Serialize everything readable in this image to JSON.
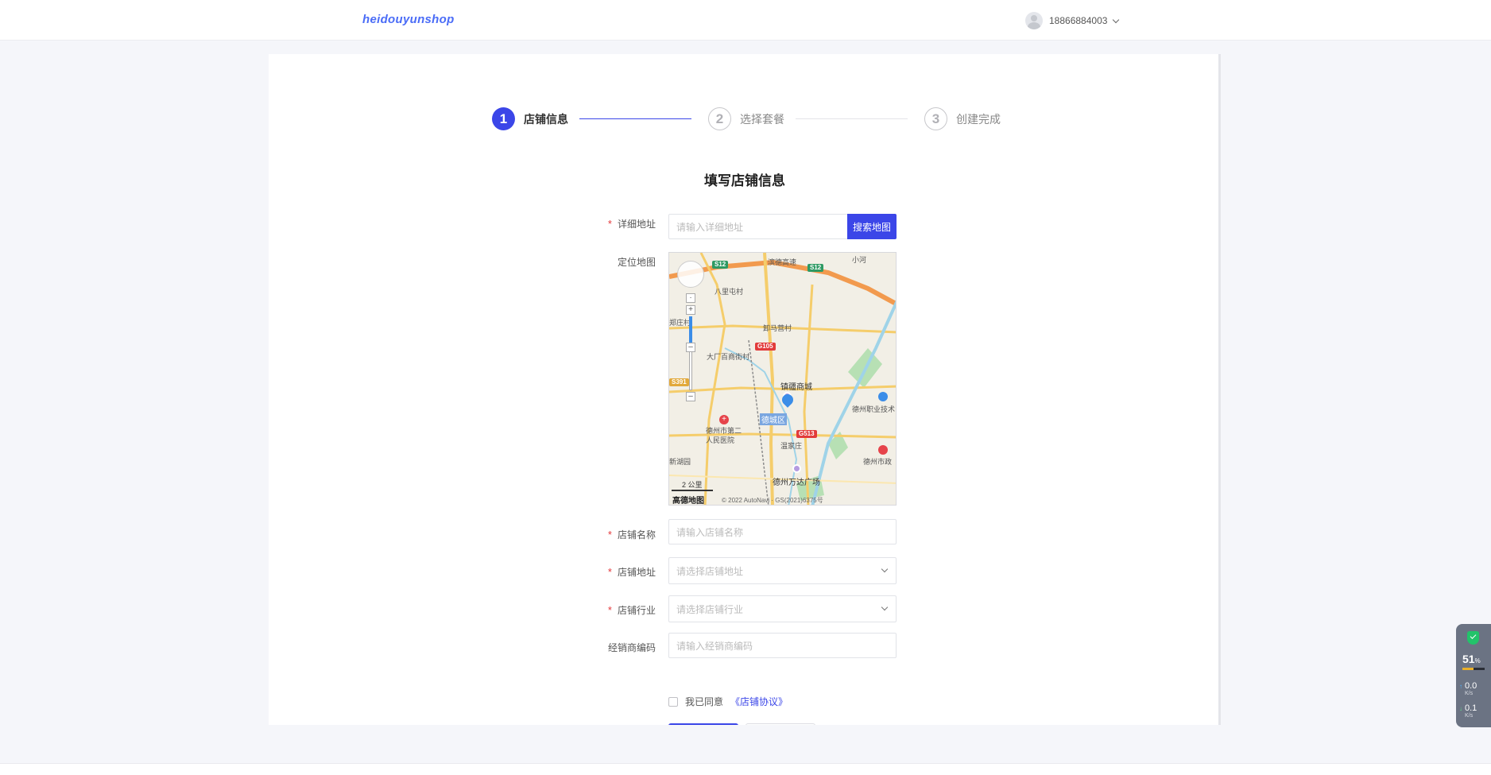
{
  "header": {
    "logo_text": "heidouyunshop",
    "user_phone": "18866884003"
  },
  "steps": [
    {
      "number": "1",
      "label": "店铺信息",
      "state": "active"
    },
    {
      "number": "2",
      "label": "选择套餐",
      "state": "inactive"
    },
    {
      "number": "3",
      "label": "创建完成",
      "state": "inactive"
    }
  ],
  "form": {
    "title": "填写店铺信息",
    "address": {
      "label": "详细地址",
      "placeholder": "请输入详细地址",
      "required": true
    },
    "search_button": "搜索地图",
    "map": {
      "label": "定位地图",
      "labels": {
        "binde": "滨德高速",
        "bali": "八里屯村",
        "xiaohe": "小河",
        "bianying": "卸马营村",
        "dahuo": "大厂百商街村",
        "zhenqing": "镇疆商城",
        "dezhou_vocational": "德州职业技术",
        "decheng": "德城区",
        "hospital": "德州市第二人民医院",
        "wenjiazhuang": "温家庄",
        "wanda": "德州万达广场",
        "gov": "德州市政",
        "west_edge": "郑庄村",
        "south_edge": "新湖园",
        "scale": "2 公里",
        "logo": "高德地图",
        "copyright": "© 2022 AutoNavi · GS(2021)6375号"
      },
      "road_tags": [
        "S12",
        "S12",
        "G105",
        "S391",
        "G513"
      ]
    },
    "shop_name": {
      "label": "店铺名称",
      "placeholder": "请输入店铺名称",
      "required": true
    },
    "shop_address": {
      "label": "店铺地址",
      "placeholder": "请选择店铺地址",
      "required": true
    },
    "shop_industry": {
      "label": "店铺行业",
      "placeholder": "请选择店铺行业",
      "required": true
    },
    "dealer_code": {
      "label": "经销商编码",
      "placeholder": "请输入经销商编码",
      "required": false
    },
    "agree_text": "我已同意",
    "agree_link": "《店铺协议》"
  },
  "net_widget": {
    "percent": "51",
    "percent_unit": "%",
    "load_fraction": 0.51,
    "up_speed": "0.0",
    "down_speed": "0.1",
    "unit": "K/s"
  },
  "colors": {
    "primary": "#3b46e8",
    "required": "#e4393c",
    "shield": "#22c36a"
  }
}
